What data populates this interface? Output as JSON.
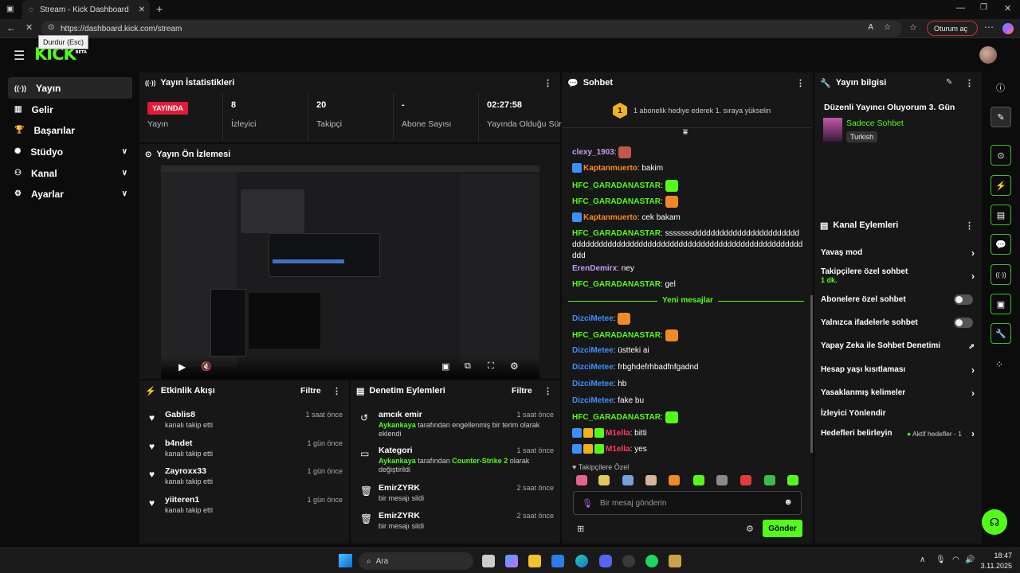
{
  "browser": {
    "tab_title": "Stream - Kick Dashboard",
    "url": "https://dashboard.kick.com/stream",
    "tooltip": "Durdur (Esc)",
    "login_button": "Oturum aç"
  },
  "logo": {
    "text": "KICK",
    "tag": "BETA"
  },
  "sidebar": {
    "items": [
      {
        "label": "Yayın",
        "icon": "broadcast-icon",
        "active": true
      },
      {
        "label": "Gelir",
        "icon": "revenue-icon"
      },
      {
        "label": "Başarılar",
        "icon": "trophy-icon"
      },
      {
        "label": "Stüdyo",
        "icon": "studio-icon"
      },
      {
        "label": "Kanal",
        "icon": "channel-icon"
      },
      {
        "label": "Ayarlar",
        "icon": "gear-icon"
      }
    ]
  },
  "stats": {
    "title": "Yayın İstatistikleri",
    "live_badge": "YAYINDA",
    "items": [
      {
        "value": "",
        "label": "Yayın"
      },
      {
        "value": "8",
        "label": "İzleyici"
      },
      {
        "value": "20",
        "label": "Takipçi"
      },
      {
        "value": "-",
        "label": "Abone Sayısı"
      },
      {
        "value": "02:27:58",
        "label": "Yayında Olduğu Süre"
      }
    ]
  },
  "preview": {
    "title": "Yayın Ön İzlemesi"
  },
  "activity": {
    "title": "Etkinlik Akışı",
    "filter": "Filtre",
    "items": [
      {
        "name": "Gablis8",
        "sub": "kanalı takip etti",
        "time": "1 saat önce"
      },
      {
        "name": "b4ndet",
        "sub": "kanalı takip etti",
        "time": "1 gün önce"
      },
      {
        "name": "Zayroxx33",
        "sub": "kanalı takip etti",
        "time": "1 gün önce"
      },
      {
        "name": "yiiteren1",
        "sub": "kanalı takip etti",
        "time": "1 gün önce"
      }
    ]
  },
  "moderation": {
    "title": "Denetim Eylemleri",
    "filter": "Filtre",
    "items": [
      {
        "name": "amcık emir",
        "actor": "Aykankaya",
        "sub": " tarafından engellenmiş bir terim olarak eklendi",
        "time": "1 saat önce",
        "icon": "history-icon"
      },
      {
        "name": "Kategori",
        "actor": "Aykankaya",
        "mid": " tarafından ",
        "target": "Counter-Strike 2",
        "sub": " olarak değiştirildi",
        "time": "1 saat önce",
        "icon": "category-icon"
      },
      {
        "name": "EmirZYRK",
        "sub": "bir mesajı sildi",
        "time": "2 saat önce",
        "icon": "trash-icon"
      },
      {
        "name": "EmirZYRK",
        "sub": "bir mesajı sildi",
        "time": "2 saat önce",
        "icon": "trash-icon"
      }
    ]
  },
  "chat": {
    "title": "Sohbet",
    "gift_banner": "1 abonelik hediye ederek 1. sıraya yükselin",
    "gift_count": "1",
    "new_messages": "Yeni mesajlar",
    "followers_only": "Takipçilere Özel",
    "input_placeholder": "Bir mesaj gönderin",
    "send": "Gönder",
    "messages": [
      {
        "user": "clexy_1903",
        "color": "#c79cf4",
        "text": "",
        "emote": true
      },
      {
        "user": "Kaptanmuerto",
        "color": "#ff8a1c",
        "text": "bakim",
        "badge": true
      },
      {
        "user": "HFC_GARADANASTAR",
        "color": "#53fc18",
        "text": "",
        "emote": true
      },
      {
        "user": "HFC_GARADANASTAR",
        "color": "#53fc18",
        "text": "",
        "emote": true
      },
      {
        "user": "Kaptanmuerto",
        "color": "#ff8a1c",
        "text": "cek bakam",
        "badge": true
      },
      {
        "user": "HFC_GARADANASTAR",
        "color": "#53fc18",
        "text": "sssssssddddddddddddddddddddddddddddddddddddddddddddddddddddddddddddddddddddddddddddddd"
      },
      {
        "user": "ErenDemirx",
        "color": "#c79cf4",
        "text": "ney"
      },
      {
        "user": "HFC_GARADANASTAR",
        "color": "#53fc18",
        "text": "gel"
      },
      {
        "user": "DizciMetee",
        "color": "#3f8eff",
        "text": "",
        "emote": true
      },
      {
        "user": "HFC_GARADANASTAR",
        "color": "#53fc18",
        "text": "",
        "emote": true
      },
      {
        "user": "DizciMetee",
        "color": "#3f8eff",
        "text": "üstteki ai"
      },
      {
        "user": "DizciMetee",
        "color": "#3f8eff",
        "text": "frbghdefrhbadfnfgadnd"
      },
      {
        "user": "DizciMetee",
        "color": "#3f8eff",
        "text": "hb"
      },
      {
        "user": "DizciMetee",
        "color": "#3f8eff",
        "text": "fake bu"
      },
      {
        "user": "HFC_GARADANASTAR",
        "color": "#53fc18",
        "text": "",
        "emote": true
      },
      {
        "user": "M1ella",
        "color": "#ff3b5c",
        "text": "bitti",
        "badges3": true
      },
      {
        "user": "M1ella",
        "color": "#ff3b5c",
        "text": "yes",
        "badges3": true
      }
    ]
  },
  "stream_info": {
    "title": "Yayın bilgisi",
    "stream_title": "Düzenli Yayıncı Oluyorum 3. Gün",
    "category": "Sadece Sohbet",
    "language": "Turkish"
  },
  "channel_actions": {
    "title": "Kanal Eylemleri",
    "rows": [
      {
        "label": "Yavaş mod",
        "type": "chevron"
      },
      {
        "label": "Takipçilere özel sohbet",
        "sub": "1 dk.",
        "type": "chevron"
      },
      {
        "label": "Abonelere özel sohbet",
        "type": "toggle"
      },
      {
        "label": "Yalnızca ifadelerle sohbet",
        "type": "toggle"
      },
      {
        "label": "Yapay Zeka ile Sohbet Denetimi",
        "type": "external"
      },
      {
        "label": "Hesap yaşı kısıtlaması",
        "type": "chevron"
      },
      {
        "label": "Yasaklanmış kelimeler",
        "type": "chevron"
      },
      {
        "label": "İzleyici Yönlendir",
        "type": "none"
      },
      {
        "label": "Hedefleri belirleyin",
        "extra": "Aktif hedefler - 1",
        "type": "chevron"
      }
    ]
  },
  "taskbar": {
    "search": "Ara",
    "time": "18:47",
    "date": "3.11.2025"
  }
}
